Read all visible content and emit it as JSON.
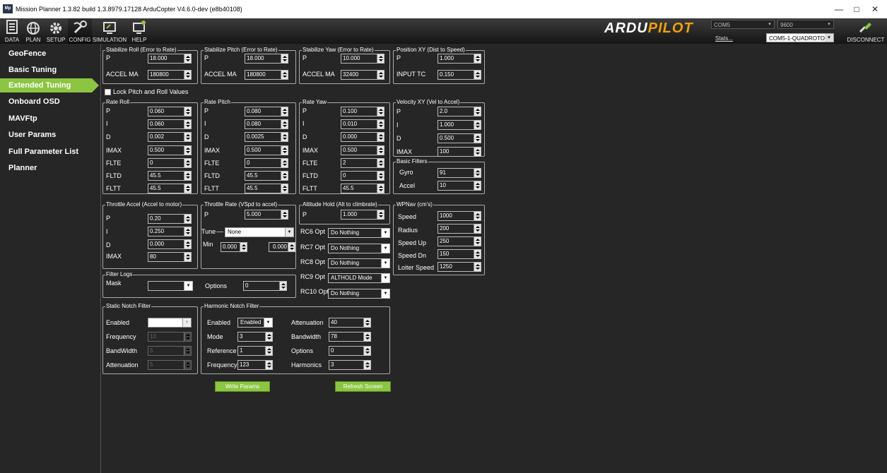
{
  "window": {
    "title": "Mission Planner 1.3.82 build 1.3.8979.17128 ArduCopter V4.6.0-dev (e8b40108)",
    "min": "—",
    "max": "□",
    "close": "✕",
    "app_icon": "Mp"
  },
  "toolbar": {
    "items": [
      "DATA",
      "PLAN",
      "SETUP",
      "CONFIG",
      "SIMULATION",
      "HELP"
    ],
    "logo_a": "ARDU",
    "logo_b": "PILOT",
    "port": "COM5",
    "baud": "9600",
    "stats": "Stats...",
    "vehicle": "COM5-1-QUADROTOR",
    "disconnect": "DISCONNECT"
  },
  "sidebar": {
    "items": [
      "GeoFence",
      "Basic Tuning",
      "Extended Tuning",
      "Onboard OSD",
      "MAVFtp",
      "User Params",
      "Full Parameter List",
      "Planner"
    ]
  },
  "groups": {
    "stab_roll": "Stabilize Roll (Error to Rate)",
    "stab_pitch": "Stabilize Pitch (Error to Rate)",
    "stab_yaw": "Stabilize Yaw (Error to Rate)",
    "pos_xy": "Position XY (Dist to Speed)",
    "rate_roll": "Rate Roll",
    "rate_pitch": "Rate Pitch",
    "rate_yaw": "Rate Yaw",
    "vel_xy": "Velocity XY (Vel to Accel)",
    "basic_filters": "Basic Filters",
    "thr_accel": "Throttle Accel (Accel to motor)",
    "thr_rate": "Throttle Rate (VSpd to accel)",
    "alt_hold": "Altitude Hold (Alt to climbrate)",
    "wpnav": "WPNav (cm's)",
    "filter_logs": "Filter Logs",
    "static_notch": "Static Notch Filter",
    "harmonic_notch": "Harmonic Notch Filter"
  },
  "labels": {
    "p": "P",
    "i": "I",
    "d": "D",
    "imax": "IMAX",
    "flte": "FLTE",
    "fltd": "FLTD",
    "fltt": "FLTT",
    "accel_ma": "ACCEL MA",
    "input_tc": "INPUT TC",
    "lock": "Lock Pitch and Roll Values",
    "gyro": "Gyro",
    "accel": "Accel",
    "tune": "Tune",
    "min": "Min",
    "speed": "Speed",
    "radius": "Radius",
    "speed_up": "Speed Up",
    "speed_dn": "Speed Dn",
    "loiter": "Loiter Speed",
    "mask": "Mask",
    "options": "Options",
    "rc6": "RC6 Opt",
    "rc7": "RC7 Opt",
    "rc8": "RC8 Opt",
    "rc9": "RC9 Opt",
    "rc10": "RC10 Opt",
    "enabled": "Enabled",
    "frequency": "Frequency",
    "bandwidth_s": "BandWidth",
    "attenuation": "Attenuation",
    "mode": "Mode",
    "reference": "Reference",
    "bandwidth": "Bandwidth",
    "harmonics": "Harmonics"
  },
  "values": {
    "sr_p": "18.000",
    "sr_accel": "180800",
    "sp_p": "18.000",
    "sp_accel": "180800",
    "sy_p": "10.000",
    "sy_accel": "32400",
    "pxy_p": "1.000",
    "pxy_tc": "0.150",
    "rr": [
      "0.060",
      "0.060",
      "0.002",
      "0.500",
      "0",
      "45.5",
      "45.5"
    ],
    "rp": [
      "0.080",
      "0.080",
      "0.0025",
      "0.500",
      "0",
      "45.5",
      "45.5"
    ],
    "ry": [
      "0.100",
      "0.010",
      "0.000",
      "0.500",
      "2",
      "0",
      "45.5"
    ],
    "vxy": [
      "2.0",
      "1.000",
      "0.500",
      "100"
    ],
    "gyro": "91",
    "accel": "10",
    "ta": [
      "0.20",
      "0.250",
      "0.000",
      "80"
    ],
    "tr_p": "5.000",
    "tune": "None",
    "min1": "0.000",
    "min2": "0.000",
    "ah_p": "1.000",
    "rc6": "Do Nothing",
    "rc7": "Do Nothing",
    "rc8": "Do Nothing",
    "rc9": "ALTHOLD Mode",
    "rc10": "Do Nothing",
    "wp": [
      "1000",
      "200",
      "250",
      "150",
      "1250"
    ],
    "mask": "",
    "fl_options": "0",
    "sn_freq": "10",
    "sn_bw": "5",
    "sn_att": "5",
    "hn_enabled": "Enabled",
    "hn_mode": "3",
    "hn_ref": "1",
    "hn_freq": "123",
    "hn_att": "40",
    "hn_bw": "78",
    "hn_opt": "0",
    "hn_harm": "3"
  },
  "buttons": {
    "write": "Write Params",
    "refresh": "Refresh Screen"
  }
}
